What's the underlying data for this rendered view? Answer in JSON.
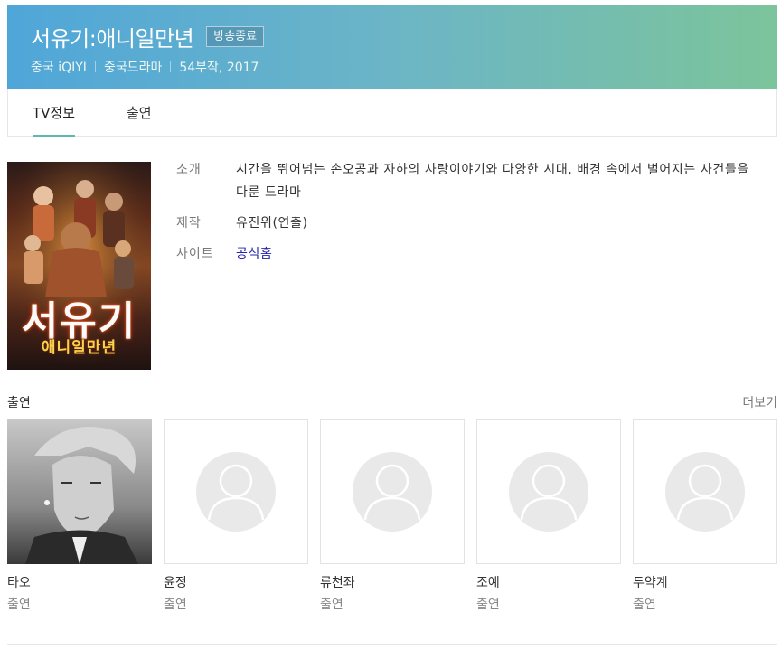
{
  "header": {
    "title": "서유기:애니일만년",
    "badge": "방송종료",
    "meta": [
      "중국 iQIYI",
      "중국드라마",
      "54부작, 2017"
    ]
  },
  "tabs": [
    {
      "label": "TV정보",
      "active": true
    },
    {
      "label": "출연",
      "active": false
    }
  ],
  "poster": {
    "title_main": "서유기",
    "title_sub": "애니일만년"
  },
  "info": {
    "intro_label": "소개",
    "intro_value": "시간을 뛰어넘는 손오공과 자하의 사랑이야기와 다양한 시대, 배경 속에서 벌어지는 사건들을 다룬 드라마",
    "producer_label": "제작",
    "producer_value": "유진위(연출)",
    "site_label": "사이트",
    "site_value": "공식홈"
  },
  "cast": {
    "title": "출연",
    "more": "더보기",
    "members": [
      {
        "name": "타오",
        "role": "출연",
        "photo": "real"
      },
      {
        "name": "윤정",
        "role": "출연",
        "photo": "placeholder"
      },
      {
        "name": "류천좌",
        "role": "출연",
        "photo": "placeholder"
      },
      {
        "name": "조예",
        "role": "출연",
        "photo": "placeholder"
      },
      {
        "name": "두약계",
        "role": "출연",
        "photo": "placeholder"
      }
    ]
  },
  "colors": {
    "header_gradient_start": "#4fa6d9",
    "header_gradient_end": "#7cc49b",
    "tab_indicator": "#5db8b1",
    "link": "#2222aa"
  }
}
